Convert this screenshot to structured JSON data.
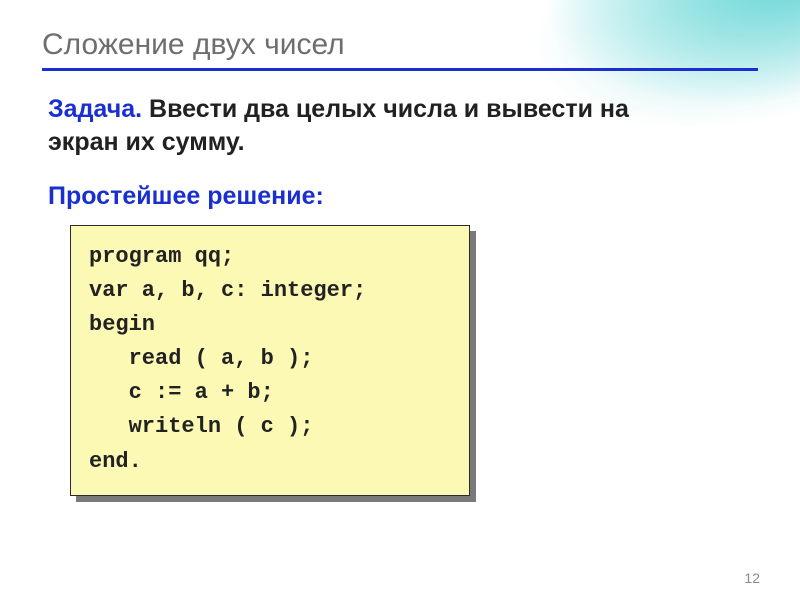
{
  "title": "Сложение двух чисел",
  "task": {
    "label": "Задача.",
    "text_line1": " Ввести два целых числа и вывести на",
    "text_line2": "экран их сумму."
  },
  "subhead": "Простейшее решение:",
  "code": {
    "l1": "program qq;",
    "l2": "var a, b, c: integer;",
    "l3": "begin",
    "l4": "   read ( a, b );",
    "l5": "   c := a + b;",
    "l6": "   writeln ( c );",
    "l7": "end."
  },
  "page_number": "12",
  "colors": {
    "accent": "#1a2fcf",
    "code_bg": "#fbf9b4"
  }
}
